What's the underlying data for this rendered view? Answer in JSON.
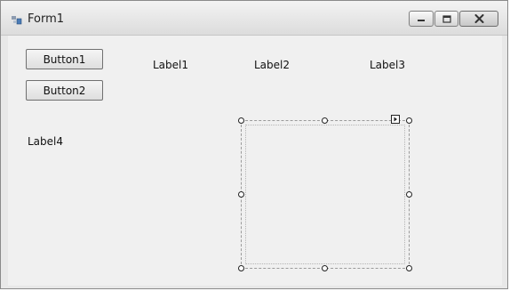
{
  "window": {
    "title": "Form1",
    "controls": {
      "minimize_icon": "minimize-icon",
      "maximize_icon": "maximize-icon",
      "close_icon": "close-icon"
    }
  },
  "form": {
    "buttons": [
      {
        "label": "Button1"
      },
      {
        "label": "Button2"
      }
    ],
    "labels": [
      "Label1",
      "Label2",
      "Label3",
      "Label4"
    ]
  },
  "selected_panel": {
    "smart_tag_icon": "arrow-right-icon"
  },
  "colors": {
    "client_bg": "#f0f0f0",
    "titlebar_bg": "#e6e6e6"
  }
}
